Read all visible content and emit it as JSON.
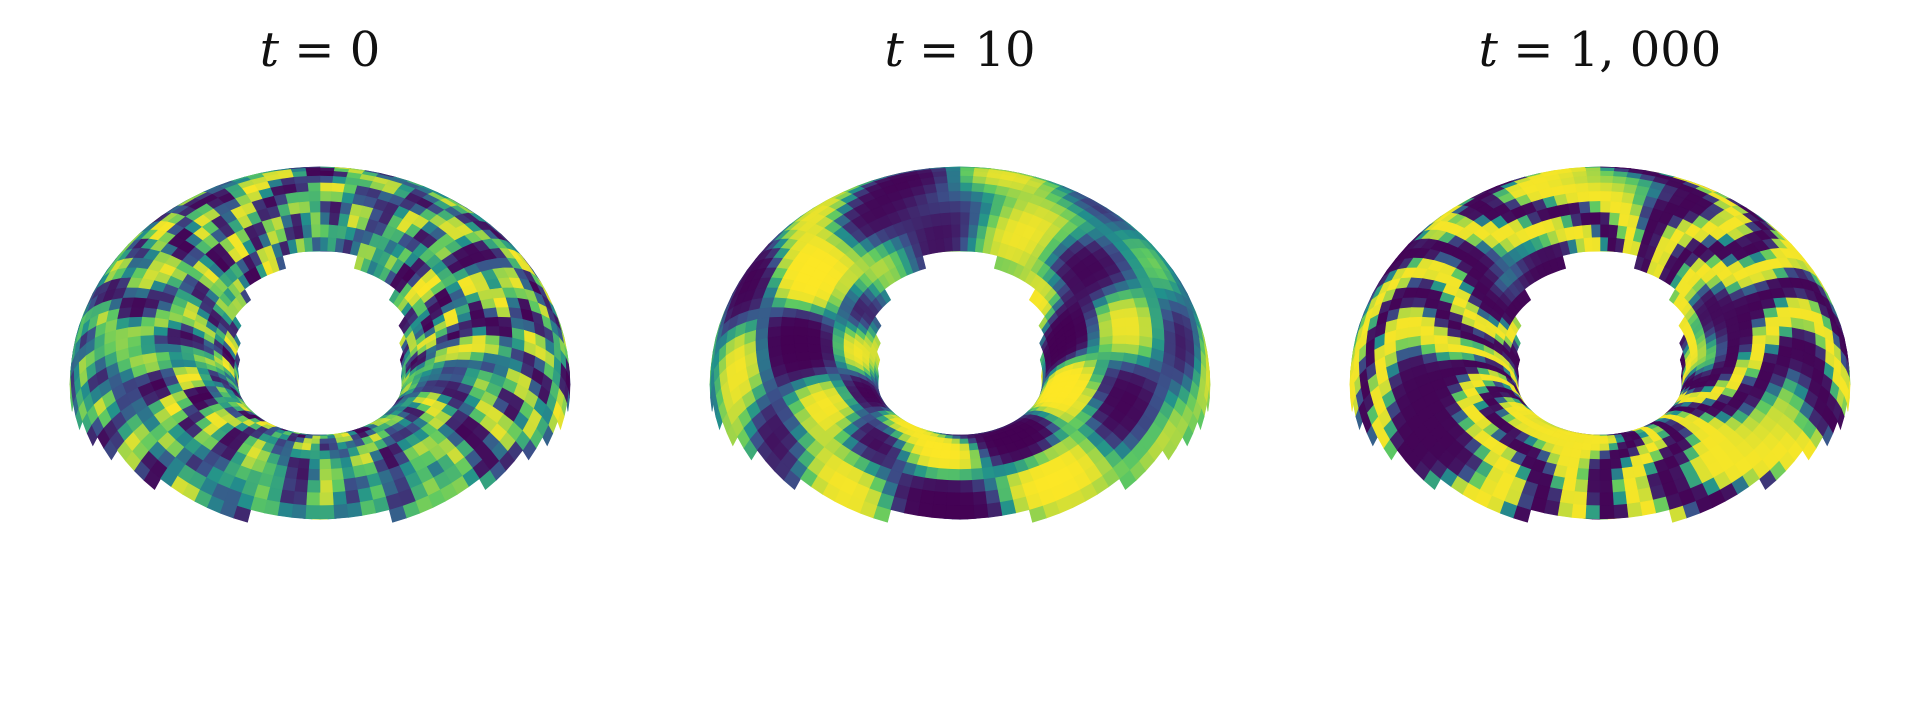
{
  "figure": {
    "panels": [
      {
        "title_var": "t",
        "title_rest": " = 0",
        "pattern": "noise",
        "seed": 7
      },
      {
        "title_var": "t",
        "title_rest": " = 10",
        "pattern": "spots",
        "seed": 31
      },
      {
        "title_var": "t",
        "title_rest": " = 1, 000",
        "pattern": "stripes",
        "seed": 53
      }
    ],
    "colormap": [
      "#440154",
      "#3b528b",
      "#21918c",
      "#5ec962",
      "#fde725"
    ]
  }
}
